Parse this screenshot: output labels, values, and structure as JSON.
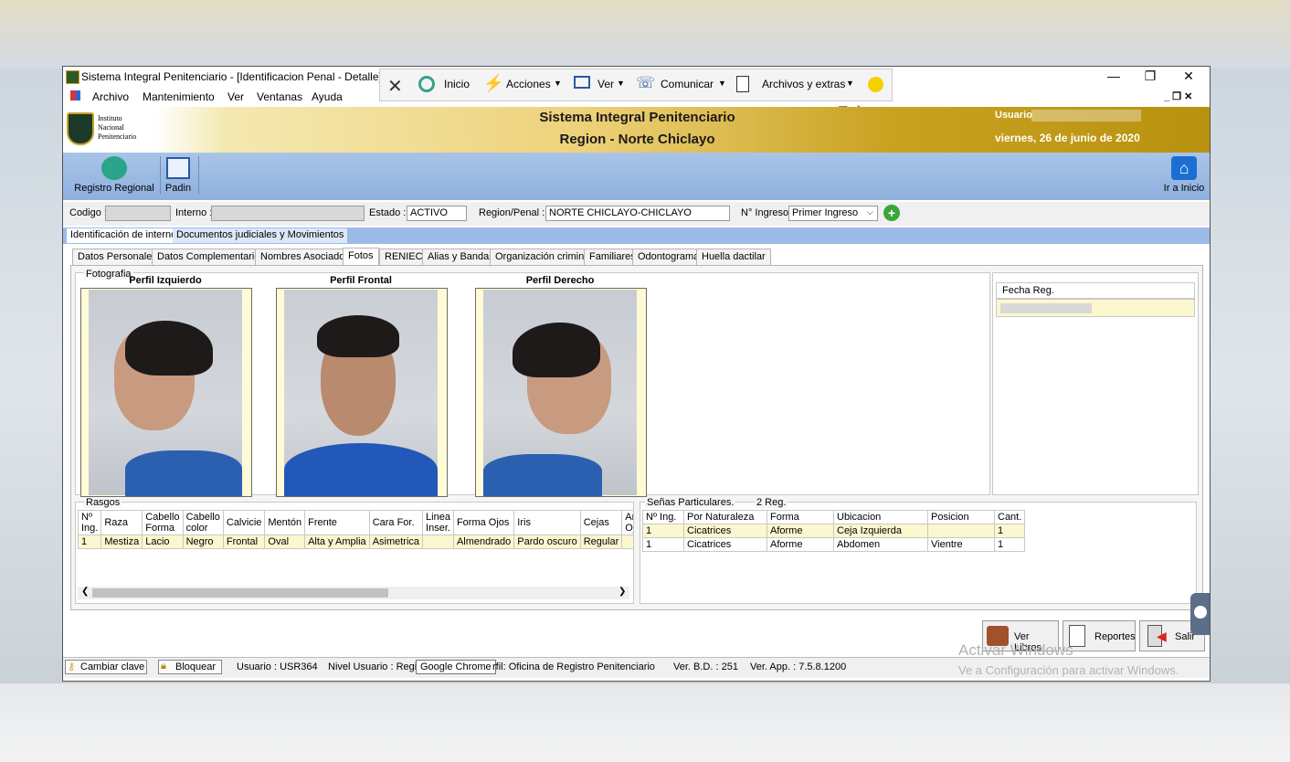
{
  "window": {
    "title": "Sistema Integral Penitenciario - [Identificacion Penal - Detalle]",
    "minimize": "—",
    "restore": "❐",
    "close": "✕"
  },
  "menu": [
    "Archivo",
    "Mantenimiento",
    "Ver",
    "Ventanas",
    "Ayuda"
  ],
  "remote_toolbar": {
    "items": [
      "Inicio",
      "Acciones",
      "Ver",
      "Comunicar",
      "Archivos y extras"
    ]
  },
  "header": {
    "logo_lines": [
      "Instituto",
      "Nacional",
      "Penitenciario"
    ],
    "title_line1": "Sistema Integral Penitenciario",
    "title_line2": "Region - Norte Chiclayo",
    "user_label": "Usuario",
    "date": "viernes, 26 de junio de 2020"
  },
  "nav": {
    "registro": "Registro Regional",
    "padin": "Padin",
    "home": "Ir a Inicio"
  },
  "fields": {
    "codigo_label": "Codigo :",
    "interno_label": "Interno :",
    "estado_label": "Estado :",
    "estado_value": "ACTIVO",
    "region_label": "Region/Penal :",
    "region_value": "NORTE CHICLAYO-CHICLAYO",
    "ingreso_label": "N° Ingreso:",
    "ingreso_value": "Primer Ingreso"
  },
  "main_tabs": [
    "Identificación de interno",
    "Documentos judiciales y Movimientos"
  ],
  "sub_tabs": [
    "Datos Personales",
    "Datos Complementarios",
    "Nombres Asociados",
    "Fotos",
    "RENIEC",
    "Alias y Bandas",
    "Organización criminal",
    "Familiares",
    "Odontograma",
    "Huella dactilar"
  ],
  "photos": {
    "group_label": "Fotografia",
    "left": "Perfil Izquierdo",
    "front": "Perfil Frontal",
    "right": "Perfil Derecho",
    "fecha_header": "Fecha Reg."
  },
  "rasgos": {
    "label": "Rasgos",
    "headers": [
      "Nº Ing.",
      "Raza",
      "Cabello Forma",
      "Cabello color",
      "Calvicie",
      "Mentón",
      "Frente",
      "Cara For.",
      "Linea Inser.",
      "Forma Ojos",
      "Iris",
      "Cejas",
      "Anom Ojos"
    ],
    "rows": [
      [
        "1",
        "Mestiza",
        "Lacio",
        "Negro",
        "Frontal",
        "Oval",
        "Alta y Amplia",
        "Asimetrica",
        "",
        "Almendrado",
        "Pardo oscuro",
        "Regular",
        ""
      ]
    ]
  },
  "senas": {
    "label": "Señas Particulares.",
    "count": "2 Reg.",
    "headers": [
      "Nº Ing.",
      "Por Naturaleza",
      "Forma",
      "Ubicacion",
      "Posicion",
      "Cant."
    ],
    "rows": [
      [
        "1",
        "Cicatrices",
        "Aforme",
        "Ceja Izquierda",
        "",
        "1"
      ],
      [
        "1",
        "Cicatrices",
        "Aforme",
        "Abdomen",
        "Vientre",
        "1"
      ]
    ]
  },
  "buttons": {
    "libros": "Ver Libros",
    "reportes": "Reportes",
    "salir": "Salir"
  },
  "status": {
    "cambiar": "Cambiar clave",
    "bloquear": "Bloquear",
    "usuario": "Usuario : USR364",
    "nivel": "Nivel Usuario : Regi",
    "tooltip": "Google Chrome",
    "perfil": "rfil: Oficina de Registro Penitenciario",
    "bd": "Ver. B.D. : 251",
    "app": "Ver. App. : 7.5.8.1200"
  },
  "watermark": {
    "line1": "Activar Windows",
    "line2": "Ve a Configuración para activar Windows."
  },
  "colors": {
    "header_gold": "#c9a221",
    "nav_blue": "#9cbbe8",
    "selected_row": "#fbf7cf"
  }
}
